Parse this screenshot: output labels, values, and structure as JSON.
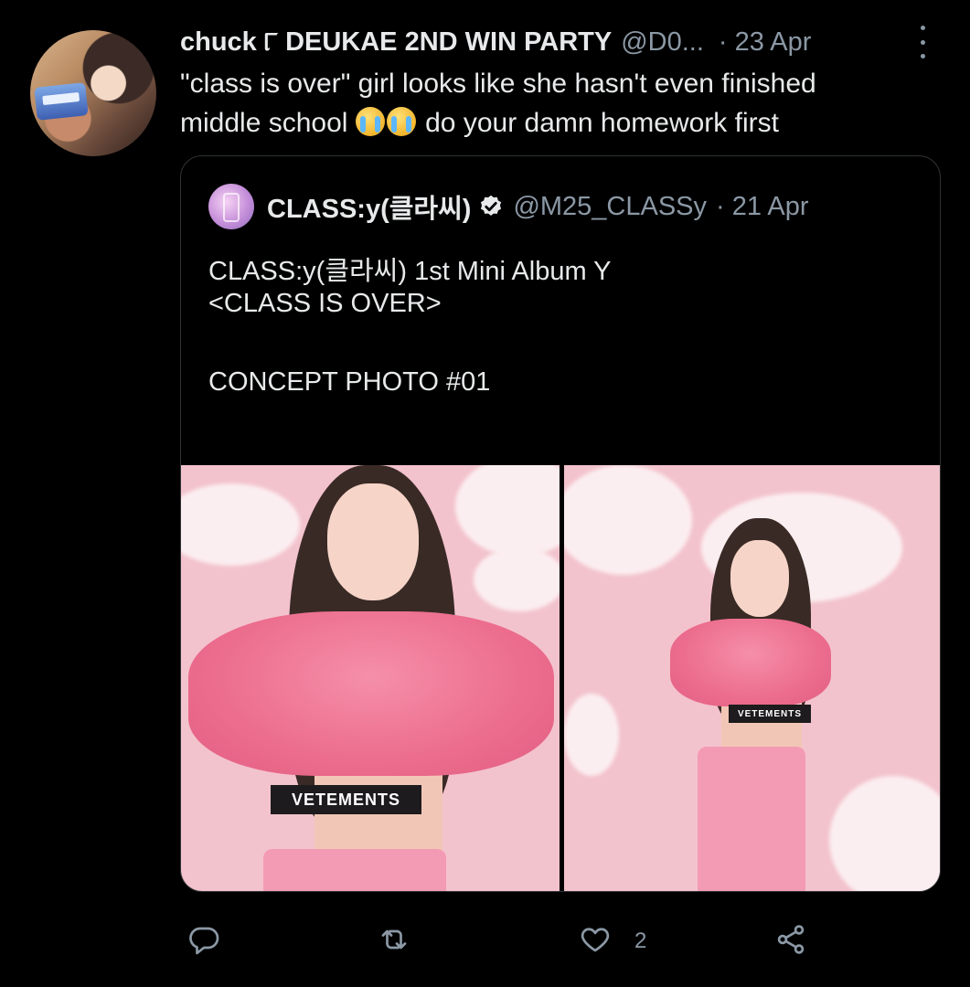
{
  "tweet": {
    "author_name": "chuck ୮ DEUKAE 2ND WIN PARTY",
    "author_handle": "@D0...",
    "separator": "·",
    "date": "23 Apr",
    "text_line1": "\"class is over\" girl looks like she hasn't even finished",
    "text_line2_pre": "middle school",
    "text_line2_post": "do your damn homework first"
  },
  "quoted_tweet": {
    "author_name": "CLASS:y(클라씨)",
    "author_handle": "@M25_CLASSy",
    "separator": "·",
    "date": "21 Apr",
    "line1": "CLASS:y(클라씨) 1st Mini Album Y",
    "line2": "<CLASS IS OVER>",
    "line3": "CONCEPT PHOTO #01",
    "more": "...",
    "photo_band_text": "VETEMENTS"
  },
  "actions": {
    "like_count": "2"
  },
  "icons": [
    "more-icon",
    "verified-icon",
    "reply-icon",
    "retweet-icon",
    "like-icon",
    "share-icon",
    "crying-emoji-icon"
  ],
  "colors": {
    "background": "#000000",
    "text": "#e7e9ea",
    "muted": "#8b98a5",
    "border": "#2f3336"
  }
}
